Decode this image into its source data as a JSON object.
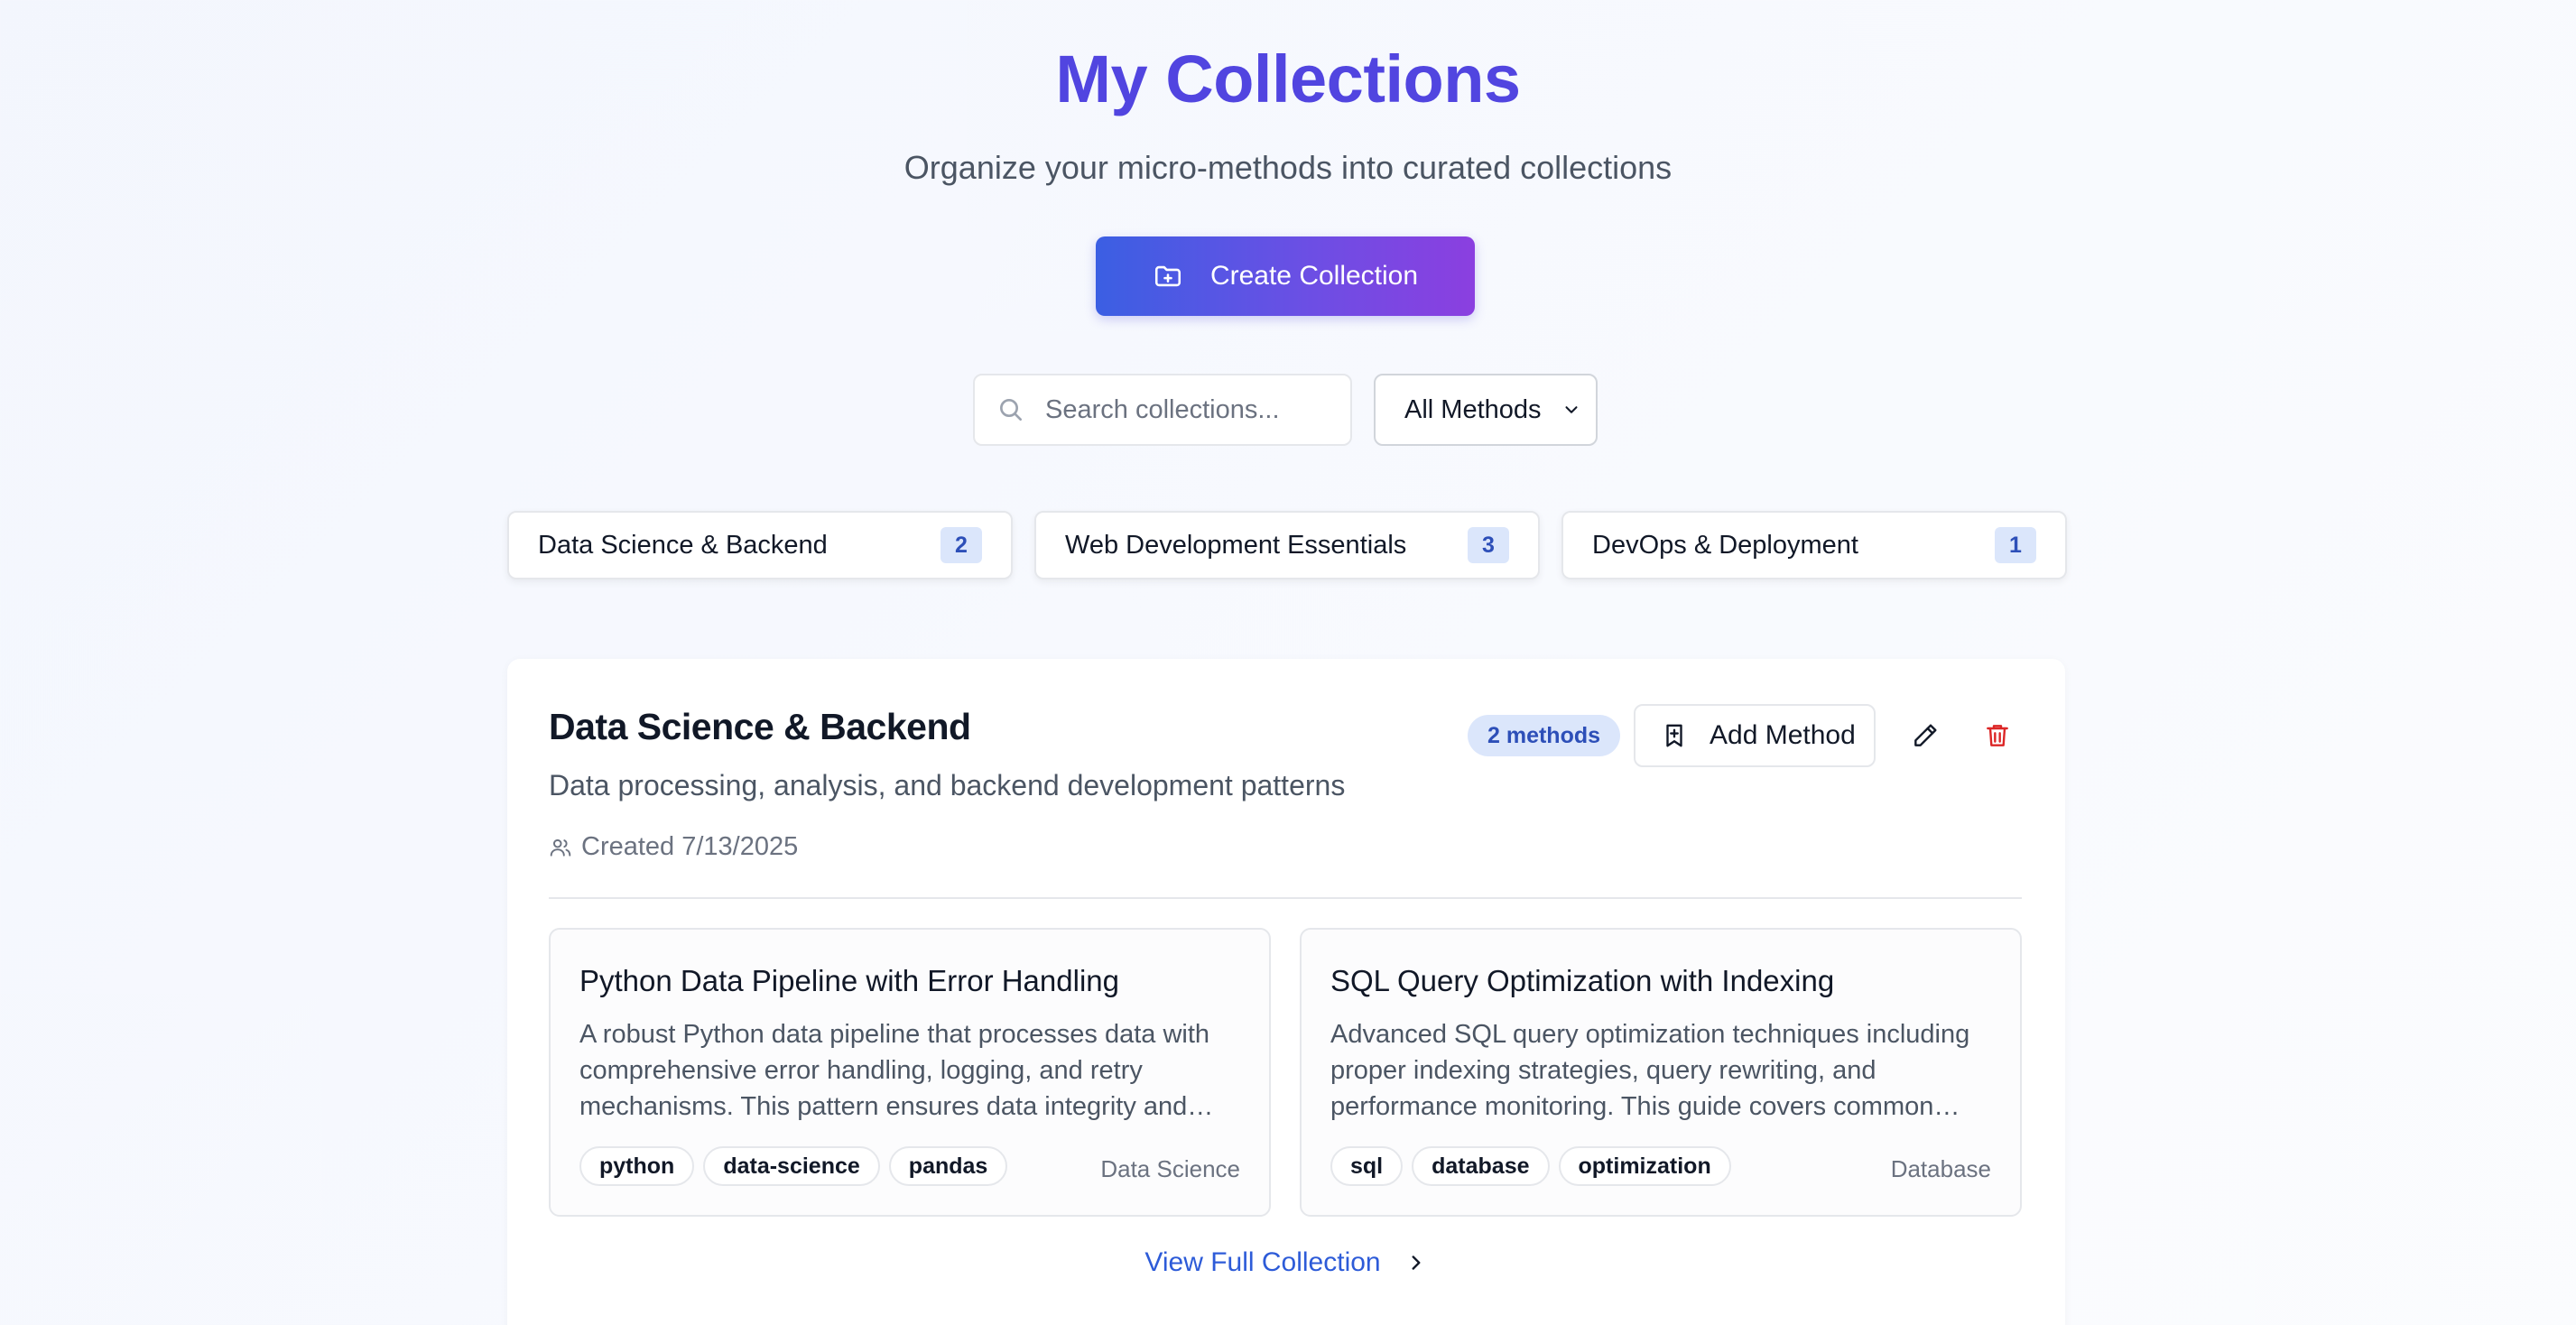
{
  "header": {
    "title": "My Collections",
    "subtitle": "Organize your micro-methods into curated collections",
    "create_label": "Create Collection"
  },
  "toolbar": {
    "search_placeholder": "Search collections...",
    "filter_selected": "All Methods"
  },
  "tabs": [
    {
      "label": "Data Science & Backend",
      "count": "2"
    },
    {
      "label": "Web Development Essentials",
      "count": "3"
    },
    {
      "label": "DevOps & Deployment",
      "count": "1"
    }
  ],
  "collection": {
    "title": "Data Science & Backend",
    "description": "Data processing, analysis, and backend development patterns",
    "created": "Created 7/13/2025",
    "methods_badge": "2 methods",
    "add_method_label": "Add Method",
    "view_full_label": "View Full Collection",
    "methods": [
      {
        "title": "Python Data Pipeline with Error Handling",
        "description": "A robust Python data pipeline that processes data with comprehensive error handling, logging, and retry mechanisms. This pattern ensures data integrity and…",
        "tags": [
          "python",
          "data-science",
          "pandas"
        ],
        "category": "Data Science"
      },
      {
        "title": "SQL Query Optimization with Indexing",
        "description": "Advanced SQL query optimization techniques including proper indexing strategies, query rewriting, and performance monitoring. This guide covers common…",
        "tags": [
          "sql",
          "database",
          "optimization"
        ],
        "category": "Database"
      }
    ]
  },
  "colors": {
    "title": "#5145e0",
    "accent": "#2d5bd8",
    "badge_bg": "#dbe6fb",
    "delete": "#dc2626"
  },
  "icons": {
    "create": "folder-plus-icon",
    "search": "search-icon",
    "select": "chevron-down-icon",
    "meta": "users-icon",
    "add": "bookmark-plus-icon",
    "edit": "pencil-icon",
    "delete": "trash-icon",
    "view": "chevron-right-icon"
  }
}
